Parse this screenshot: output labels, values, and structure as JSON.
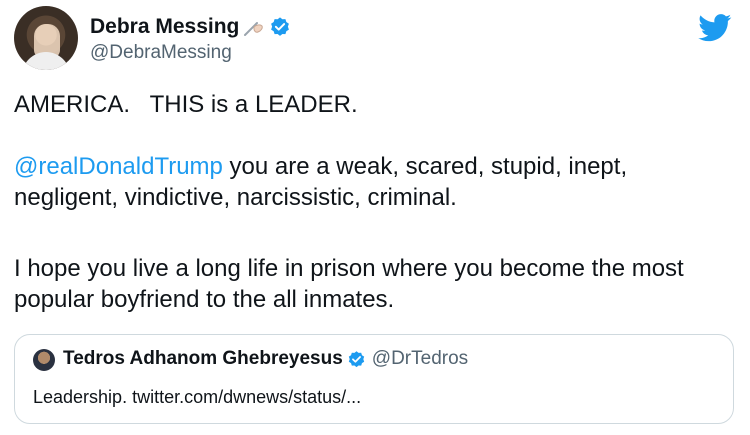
{
  "author": {
    "display_name": "Debra Messing",
    "emoji": "writing-hand-emoji",
    "verified_icon": "verified-badge-icon",
    "handle": "@DebraMessing"
  },
  "brand": {
    "logo": "twitter-bird-icon",
    "accent": "#1d9bf0"
  },
  "tweet": {
    "line1": "AMERICA.   THIS is a LEADER.",
    "mention": "@realDonaldTrump",
    "para2_rest": " you are a weak, scared, stupid, inept, negligent, vindictive, narcissistic, criminal.",
    "para3": "I hope you live a long life in prison where you become the most popular boyfriend to the all inmates."
  },
  "quoted_tweet": {
    "display_name": "Tedros Adhanom Ghebreyesus",
    "verified_icon": "verified-badge-icon",
    "handle": "@DrTedros",
    "text": "Leadership. twitter.com/dwnews/status/..."
  }
}
